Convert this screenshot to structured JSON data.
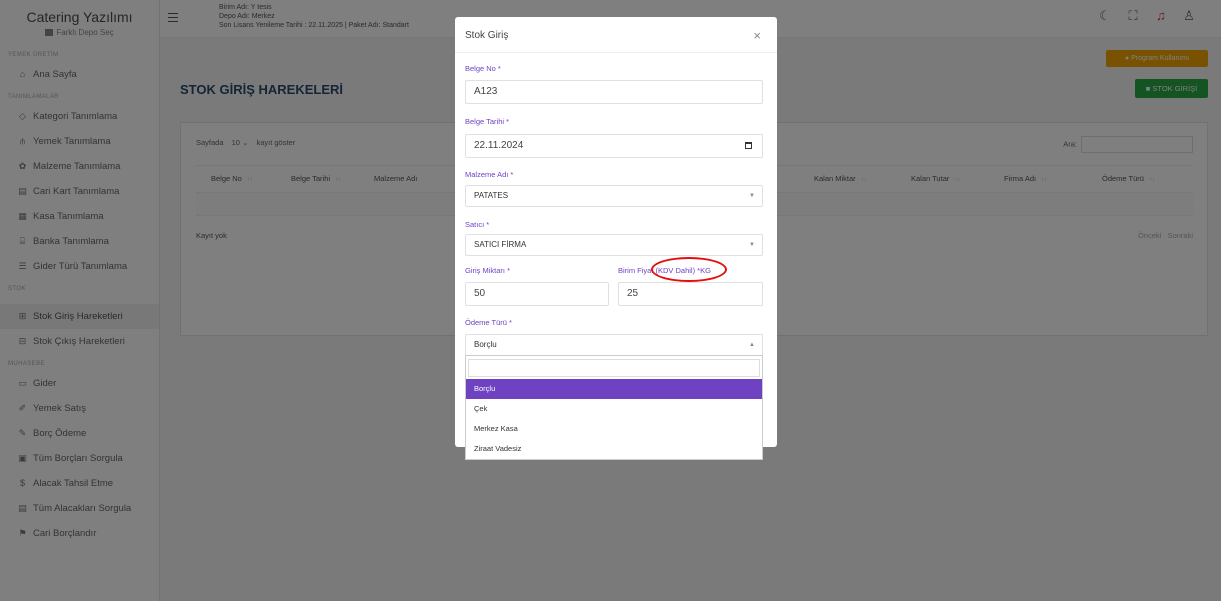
{
  "app": {
    "title": "Catering Yazılımı",
    "depot_switch": "Farklı Depo Seç"
  },
  "sidebar": {
    "sections": [
      "YEMEK ÜRETİM",
      "TANIMLAMALAR",
      "STOK",
      "MUHASEBE"
    ],
    "items": [
      {
        "label": "Ana Sayfa",
        "icon": "home-icon"
      },
      {
        "label": "Kategori Tanımlama",
        "icon": "tag-icon"
      },
      {
        "label": "Yemek Tanımlama",
        "icon": "utensils-icon"
      },
      {
        "label": "Malzeme Tanımlama",
        "icon": "carrot-icon"
      },
      {
        "label": "Cari Kart Tanımlama",
        "icon": "card-icon"
      },
      {
        "label": "Kasa Tanımlama",
        "icon": "cash-register-icon"
      },
      {
        "label": "Banka Tanımlama",
        "icon": "bank-icon"
      },
      {
        "label": "Gider Türü Tanımlama",
        "icon": "list-icon"
      },
      {
        "label": "Stok Giriş Hareketleri",
        "icon": "stock-in-icon",
        "active": true
      },
      {
        "label": "Stok Çıkış Hareketleri",
        "icon": "stock-out-icon"
      },
      {
        "label": "Gider",
        "icon": "expense-icon"
      },
      {
        "label": "Yemek Satış",
        "icon": "sale-icon"
      },
      {
        "label": "Borç Ödeme",
        "icon": "payment-icon"
      },
      {
        "label": "Tüm Borçları Sorgula",
        "icon": "query-icon"
      },
      {
        "label": "Alacak Tahsil Etme",
        "icon": "collect-icon"
      },
      {
        "label": "Tüm Alacakları Sorgula",
        "icon": "receivable-icon"
      },
      {
        "label": "Cari Borçlandır",
        "icon": "debit-icon"
      }
    ]
  },
  "topbar": {
    "unit": "Birim Adı: Y tesis",
    "depot": "Depo Adı: Merkez",
    "license": "Son Lisans Yenileme Tarihi : 22.11.2025 | Paket Adı: Standart",
    "icons": [
      "moon-icon",
      "fullscreen-icon",
      "bell-icon",
      "user-icon"
    ]
  },
  "page": {
    "title": "STOK GİRİŞ HAREKELERİ",
    "help_button": "Program Kullanımı",
    "add_button": "STOK GİRİŞİ",
    "table": {
      "length_prefix": "Sayfada",
      "length_value": "10",
      "length_suffix": "kayıt göster",
      "search_label": "Ara:",
      "columns": [
        "Belge No",
        "Belge Tarihi",
        "Malzeme Adı",
        "Kalan Miktar",
        "Kalan Tutar",
        "Firma Adı",
        "Ödeme Türü"
      ],
      "empty": "Kayıt yok",
      "prev": "Önceki",
      "next": "Sonraki"
    }
  },
  "modal": {
    "title": "Stok Giriş",
    "fields": {
      "belge_no": {
        "label": "Belge No *",
        "value": "A123"
      },
      "belge_tarihi": {
        "label": "Belge Tarihi *",
        "value": "22.11.2024"
      },
      "malzeme": {
        "label": "Malzeme Adı *",
        "value": "PATATES"
      },
      "satici": {
        "label": "Satıcı *",
        "value": "SATICI FİRMA"
      },
      "miktar": {
        "label": "Giriş Miktarı *",
        "value": "50"
      },
      "fiyat": {
        "label": "Birim Fiyat (KDV Dahil) *KG",
        "value": "25"
      },
      "odeme": {
        "label": "Ödeme Türü *",
        "value": "Borçlu"
      }
    },
    "dropdown_options": [
      "Borçlu",
      "Çek",
      "Merkez Kasa",
      "Ziraat Vadesiz"
    ],
    "selected_option": "Borçlu"
  },
  "colors": {
    "accent": "#6f42c1",
    "success": "#28a745",
    "warning": "#f0a500",
    "annotation": "#e01010"
  }
}
